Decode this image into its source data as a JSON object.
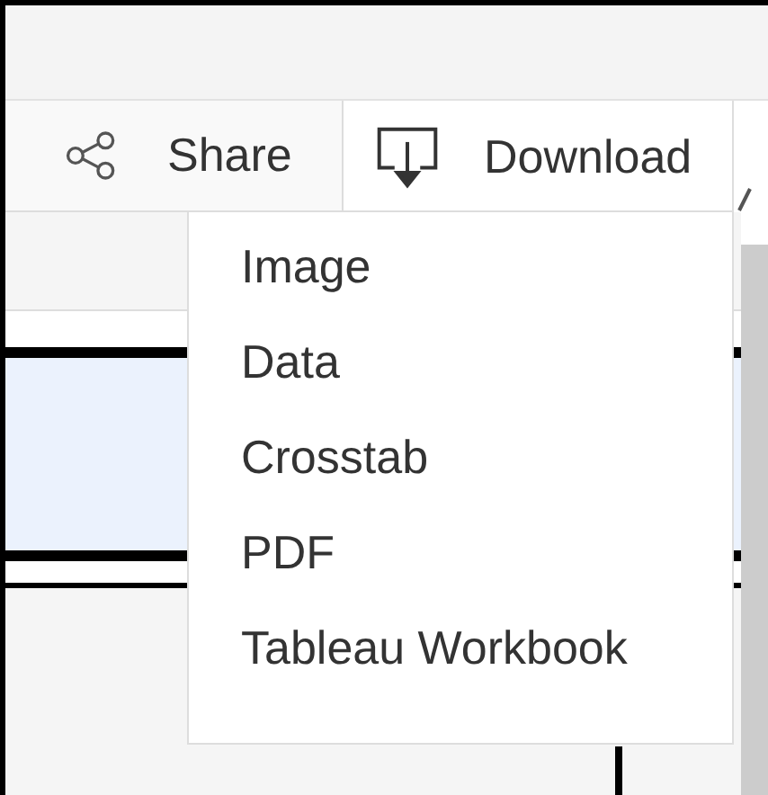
{
  "toolbar": {
    "buttons": [
      {
        "label": "Share",
        "kind": "share",
        "selected": false
      },
      {
        "label": "Download",
        "kind": "download",
        "selected": true
      }
    ]
  },
  "download_menu": {
    "items": [
      "Image",
      "Data",
      "Crosstab",
      "PDF",
      "Tableau Workbook"
    ]
  }
}
